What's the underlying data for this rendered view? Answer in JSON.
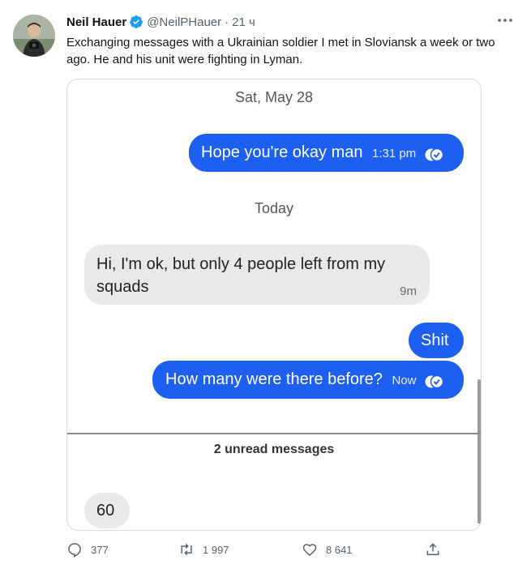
{
  "tweet": {
    "author_name": "Neil Hauer",
    "handle": "@NeilPHauer",
    "separator": "·",
    "time": "21 ч",
    "text": "Exchanging messages with a Ukrainian soldier I met in Sloviansk a week or two ago. He and his unit were fighting in Lyman."
  },
  "chat": {
    "date_1": "Sat, May 28",
    "date_2": "Today",
    "messages": [
      {
        "text": "Hope you're okay man",
        "time": "1:31 pm",
        "direction": "outgoing"
      },
      {
        "text_line1": "Hi, I'm ok, but only 4 people  left from my",
        "text_line2": "squads",
        "time": "9m",
        "direction": "incoming"
      },
      {
        "text": "Shit",
        "direction": "outgoing"
      },
      {
        "text": "How many were there before?",
        "time": "Now",
        "direction": "outgoing"
      },
      {
        "text": "60",
        "direction": "incoming"
      }
    ],
    "unread_label": "2 unread messages"
  },
  "actions": {
    "replies": "377",
    "retweets": "1 997",
    "likes": "8 641"
  },
  "colors": {
    "outgoing_bubble": "#1d5ff0",
    "incoming_bubble": "#e9e9eb",
    "verified_badge": "#1d9bf0"
  },
  "icons": [
    "verified-icon",
    "more-icon",
    "reply-icon",
    "retweet-icon",
    "like-icon",
    "share-icon",
    "read-receipt-icon"
  ]
}
